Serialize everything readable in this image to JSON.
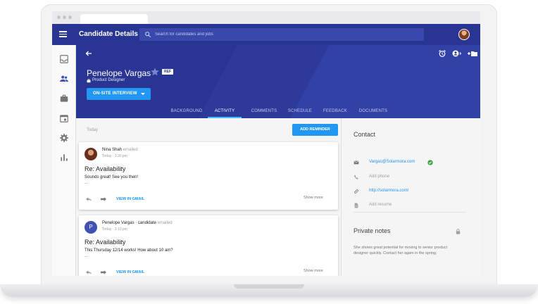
{
  "app": {
    "title": "Candidate Details",
    "search_placeholder": "Search for candidates and jobs"
  },
  "colors": {
    "app_bar": "#283593",
    "accent": "#2196f3",
    "active_tab_indicator": "#40c4ff",
    "verified": "#43a047"
  },
  "rail": {
    "items": [
      {
        "icon": "inbox-icon"
      },
      {
        "icon": "candidates-icon"
      },
      {
        "icon": "briefcase-icon"
      },
      {
        "icon": "calendar-icon"
      },
      {
        "icon": "gear-icon"
      },
      {
        "icon": "bar-chart-icon"
      }
    ]
  },
  "header": {
    "toolbar_icons": [
      "back-arrow-icon",
      "alarm-icon",
      "account-icon",
      "add-folder-icon",
      "more-vertical-icon"
    ],
    "candidate_name": "Penelope Vargas",
    "ref_badge": "REF",
    "role": "Product Designer",
    "stage_button": "ON-SITE INTERVIEW",
    "tabs": [
      {
        "label": "BACKGROUND",
        "active": false
      },
      {
        "label": "ACTIVITY",
        "active": true
      },
      {
        "label": "COMMENTS",
        "active": false
      },
      {
        "label": "SCHEDULE",
        "active": false
      },
      {
        "label": "FEEDBACK",
        "active": false
      },
      {
        "label": "DOCUMENTS",
        "active": false
      }
    ]
  },
  "activity": {
    "date_label": "Today",
    "add_reminder": "ADD REMINDER",
    "items": [
      {
        "sender": "Nina Shah",
        "sender_meta": "emailed",
        "time": "Today · 3:30 pm",
        "subject": "Re: Availability",
        "body": "Sounds great! See you then!",
        "ellipsis": "...",
        "view_link": "VIEW IN GMAIL",
        "show_more": "Show more"
      },
      {
        "avatar_letter": "P",
        "sender": "Penelope Vargas · candidate",
        "sender_meta": "emailed",
        "time": "Today · 3:10 pm",
        "subject": "Re: Availability",
        "body": "This Thursday 12/14 works! How about 10 am?",
        "ellipsis": "...",
        "view_link": "VIEW IN GMAIL",
        "show_more": "Show more"
      }
    ]
  },
  "contact": {
    "title": "Contact",
    "email": "Vargas@Solarmora.com",
    "phone_placeholder": "Add phone",
    "website": "http://solarmora.com/",
    "resume_placeholder": "Add resume"
  },
  "notes": {
    "title": "Private notes",
    "text": "She shows great potential for moving to senior product designer quickly. Contact her again in the spring."
  }
}
